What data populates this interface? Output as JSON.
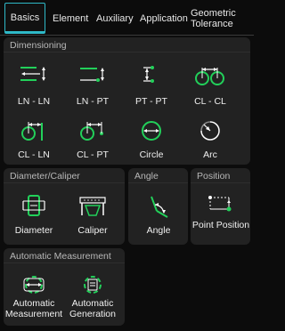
{
  "tabs": [
    {
      "label": "Basics"
    },
    {
      "label": "Element"
    },
    {
      "label": "Auxiliary"
    },
    {
      "label": "Application"
    },
    {
      "label": "Geometric Tolerance"
    }
  ],
  "accent": "#2fb9c8",
  "icon_green": "#22d05a",
  "panels": {
    "dimensioning": {
      "title": "Dimensioning",
      "tools": [
        {
          "label": "LN - LN",
          "icon": "line-to-line-icon"
        },
        {
          "label": "LN - PT",
          "icon": "line-to-point-icon"
        },
        {
          "label": "PT - PT",
          "icon": "point-to-point-icon"
        },
        {
          "label": "CL - CL",
          "icon": "circle-to-circle-icon"
        },
        {
          "label": "CL - LN",
          "icon": "circle-to-line-icon"
        },
        {
          "label": "CL - PT",
          "icon": "circle-to-point-icon"
        },
        {
          "label": "Circle",
          "icon": "circle-icon"
        },
        {
          "label": "Arc",
          "icon": "arc-icon"
        }
      ]
    },
    "diameter": {
      "title": "Diameter/Caliper",
      "tools": [
        {
          "label": "Diameter",
          "icon": "diameter-icon"
        },
        {
          "label": "Caliper",
          "icon": "caliper-icon"
        }
      ]
    },
    "angle": {
      "title": "Angle",
      "tools": [
        {
          "label": "Angle",
          "icon": "angle-icon"
        }
      ]
    },
    "position": {
      "title": "Position",
      "tools": [
        {
          "label": "Point Position",
          "icon": "point-position-icon"
        }
      ]
    },
    "automatic": {
      "title": "Automatic Measurement",
      "tools": [
        {
          "label": "Automatic Measurement",
          "icon": "automatic-measurement-icon"
        },
        {
          "label": "Automatic Generation",
          "icon": "automatic-generation-icon"
        }
      ]
    }
  }
}
